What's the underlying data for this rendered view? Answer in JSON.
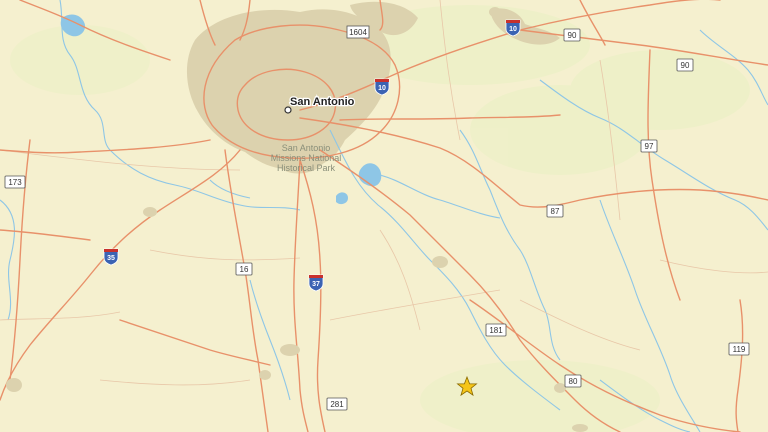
{
  "city": {
    "name": "San Antonio"
  },
  "park": {
    "line1": "San Antonio",
    "line2": "Missions National",
    "line3": "Historical Park"
  },
  "interstate_shields": [
    "10",
    "10",
    "35",
    "37"
  ],
  "us_shields": [
    "90",
    "90",
    "97",
    "87",
    "173",
    "16",
    "181",
    "281",
    "80",
    "119"
  ],
  "loop_shields": [
    "1604"
  ],
  "marker": {
    "icon": "star-icon",
    "color": "#f5c518"
  },
  "colors": {
    "background": "#f5f0cf",
    "urban": "#dcd2ae",
    "road": "#e8916a",
    "water": "#8ec6e6",
    "interstate_blue": "#3b63b3",
    "interstate_red": "#c8312d"
  }
}
